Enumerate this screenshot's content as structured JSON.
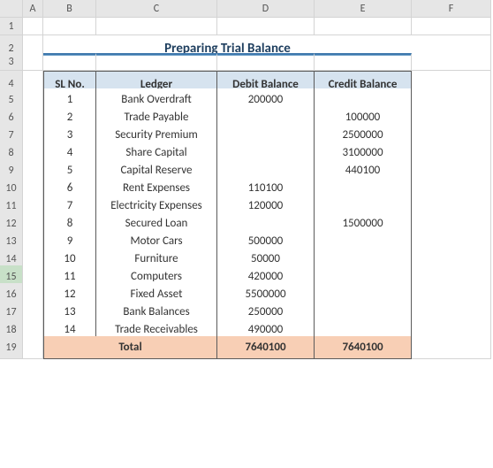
{
  "columns": [
    "A",
    "B",
    "C",
    "D",
    "E",
    "F"
  ],
  "rowHeaders": [
    "1",
    "2",
    "3",
    "4",
    "5",
    "6",
    "7",
    "8",
    "9",
    "10",
    "11",
    "12",
    "13",
    "14",
    "15",
    "16",
    "17",
    "18",
    "19"
  ],
  "selectedRow": 15,
  "title": "Preparing Trial Balance",
  "table": {
    "headers": [
      "SL No.",
      "Ledger",
      "Debit Balance",
      "Credit Balance"
    ],
    "rows": [
      {
        "sl": "1",
        "ledger": "Bank Overdraft",
        "debit": "200000",
        "credit": ""
      },
      {
        "sl": "2",
        "ledger": "Trade Payable",
        "debit": "",
        "credit": "100000"
      },
      {
        "sl": "3",
        "ledger": "Security Premium",
        "debit": "",
        "credit": "2500000"
      },
      {
        "sl": "4",
        "ledger": "Share Capital",
        "debit": "",
        "credit": "3100000"
      },
      {
        "sl": "5",
        "ledger": "Capital Reserve",
        "debit": "",
        "credit": "440100"
      },
      {
        "sl": "6",
        "ledger": "Rent Expenses",
        "debit": "110100",
        "credit": ""
      },
      {
        "sl": "7",
        "ledger": "Electricity Expenses",
        "debit": "120000",
        "credit": ""
      },
      {
        "sl": "8",
        "ledger": "Secured Loan",
        "debit": "",
        "credit": "1500000"
      },
      {
        "sl": "9",
        "ledger": "Motor Cars",
        "debit": "500000",
        "credit": ""
      },
      {
        "sl": "10",
        "ledger": "Furniture",
        "debit": "50000",
        "credit": ""
      },
      {
        "sl": "11",
        "ledger": "Computers",
        "debit": "420000",
        "credit": ""
      },
      {
        "sl": "12",
        "ledger": "Fixed Asset",
        "debit": "5500000",
        "credit": ""
      },
      {
        "sl": "13",
        "ledger": "Bank Balances",
        "debit": "250000",
        "credit": ""
      },
      {
        "sl": "14",
        "ledger": "Trade Receivables",
        "debit": "490000",
        "credit": ""
      }
    ],
    "total": {
      "label": "Total",
      "debit": "7640100",
      "credit": "7640100"
    }
  },
  "chart_data": {
    "type": "table",
    "title": "Preparing Trial Balance",
    "columns": [
      "SL No.",
      "Ledger",
      "Debit Balance",
      "Credit Balance"
    ],
    "rows": [
      [
        1,
        "Bank Overdraft",
        200000,
        null
      ],
      [
        2,
        "Trade Payable",
        null,
        100000
      ],
      [
        3,
        "Security Premium",
        null,
        2500000
      ],
      [
        4,
        "Share Capital",
        null,
        3100000
      ],
      [
        5,
        "Capital Reserve",
        null,
        440100
      ],
      [
        6,
        "Rent Expenses",
        110100,
        null
      ],
      [
        7,
        "Electricity Expenses",
        120000,
        null
      ],
      [
        8,
        "Secured Loan",
        null,
        1500000
      ],
      [
        9,
        "Motor Cars",
        500000,
        null
      ],
      [
        10,
        "Furniture",
        50000,
        null
      ],
      [
        11,
        "Computers",
        420000,
        null
      ],
      [
        12,
        "Fixed Asset",
        5500000,
        null
      ],
      [
        13,
        "Bank Balances",
        250000,
        null
      ],
      [
        14,
        "Trade Receivables",
        490000,
        null
      ]
    ],
    "totals": {
      "Debit Balance": 7640100,
      "Credit Balance": 7640100
    }
  }
}
